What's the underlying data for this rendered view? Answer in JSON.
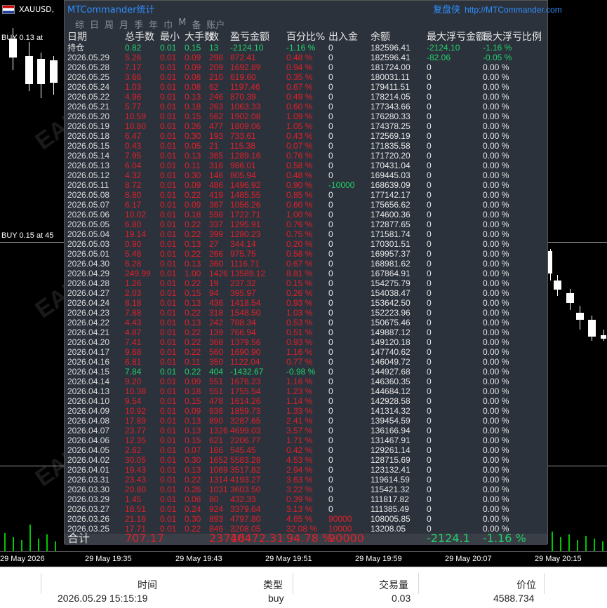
{
  "chart": {
    "symbol": "XAUUSD,",
    "label_top": "BUY 0.13 at",
    "label_mid": "BUY 0.15 at 45",
    "watermark": "EAHub.cn",
    "time_axis": [
      "29 May 2026",
      "29 May 19:35",
      "29 May 19:43",
      "29 May 19:51",
      "29 May 19:59",
      "29 May 20:07",
      "29 May 20:15"
    ]
  },
  "panel": {
    "title": "MTCommander统计",
    "brand": "复盘侠",
    "link": "http://MTCommander.com",
    "tabs": [
      "综",
      "日",
      "周",
      "月",
      "季",
      "年",
      "巾",
      "M",
      "备",
      "账户"
    ],
    "columns": [
      "日期",
      "总手数",
      "最小",
      "大手数",
      "数",
      "盈亏金额",
      "百分比%",
      "出入金",
      "余额",
      "最大浮亏金额",
      "最大浮亏比例"
    ],
    "position_row": [
      "持仓",
      "0.82",
      "0.01",
      "0.15",
      "13",
      "-2124.10",
      "-1.16 %",
      "0",
      "182596.41",
      "-2124.10",
      "-1.16 %"
    ],
    "rows": [
      [
        "2026.05.29",
        "5.26",
        "0.01",
        "0.09",
        "298",
        "872.41",
        "0.48 %",
        "0",
        "182596.41",
        "-82.06",
        "-0.05 %"
      ],
      [
        "2026.05.28",
        "7.17",
        "0.01",
        "0.09",
        "209",
        "1692.89",
        "0.94 %",
        "0",
        "181724.00",
        "0",
        "0.00 %"
      ],
      [
        "2026.05.25",
        "3.66",
        "0.01",
        "0.08",
        "210",
        "619.60",
        "0.35 %",
        "0",
        "180031.11",
        "0",
        "0.00 %"
      ],
      [
        "2026.05.24",
        "1.03",
        "0.01",
        "0.08",
        "62",
        "1197.46",
        "0.67 %",
        "0",
        "179411.51",
        "0",
        "0.00 %"
      ],
      [
        "2026.05.22",
        "4.96",
        "0.01",
        "0.13",
        "246",
        "870.39",
        "0.49 %",
        "0",
        "178214.05",
        "0",
        "0.00 %"
      ],
      [
        "2026.05.21",
        "5.77",
        "0.01",
        "0.18",
        "263",
        "1063.33",
        "0.60 %",
        "0",
        "177343.66",
        "0",
        "0.00 %"
      ],
      [
        "2026.05.20",
        "10.59",
        "0.01",
        "0.15",
        "562",
        "1902.08",
        "1.09 %",
        "0",
        "176280.33",
        "0",
        "0.00 %"
      ],
      [
        "2026.05.19",
        "10.80",
        "0.01",
        "0.26",
        "477",
        "1809.06",
        "1.05 %",
        "0",
        "174378.25",
        "0",
        "0.00 %"
      ],
      [
        "2026.05.18",
        "6.47",
        "0.01",
        "0.30",
        "193",
        "733.61",
        "0.43 %",
        "0",
        "172569.19",
        "0",
        "0.00 %"
      ],
      [
        "2026.05.15",
        "0.43",
        "0.01",
        "0.05",
        "21",
        "115.38",
        "0.07 %",
        "0",
        "171835.58",
        "0",
        "0.00 %"
      ],
      [
        "2026.05.14",
        "7.95",
        "0.01",
        "0.13",
        "365",
        "1289.16",
        "0.76 %",
        "0",
        "171720.20",
        "0",
        "0.00 %"
      ],
      [
        "2026.05.13",
        "6.04",
        "0.01",
        "0.11",
        "316",
        "986.01",
        "0.58 %",
        "0",
        "170431.04",
        "0",
        "0.00 %"
      ],
      [
        "2026.05.12",
        "4.32",
        "0.01",
        "0.30",
        "146",
        "805.94",
        "0.48 %",
        "0",
        "169445.03",
        "0",
        "0.00 %"
      ],
      [
        "2026.05.11",
        "8.72",
        "0.01",
        "0.09",
        "486",
        "1496.92",
        "0.90 %",
        "-10000",
        "168639.09",
        "0",
        "0.00 %"
      ],
      [
        "2026.05.08",
        "8.80",
        "0.01",
        "0.22",
        "419",
        "1485.55",
        "0.85 %",
        "0",
        "177142.17",
        "0",
        "0.00 %"
      ],
      [
        "2026.05.07",
        "6.17",
        "0.01",
        "0.09",
        "367",
        "1056.26",
        "0.60 %",
        "0",
        "175656.62",
        "0",
        "0.00 %"
      ],
      [
        "2026.05.06",
        "10.02",
        "0.01",
        "0.18",
        "598",
        "1722.71",
        "1.00 %",
        "0",
        "174600.36",
        "0",
        "0.00 %"
      ],
      [
        "2026.05.05",
        "6.80",
        "0.01",
        "0.22",
        "337",
        "1295.91",
        "0.76 %",
        "0",
        "172877.65",
        "0",
        "0.00 %"
      ],
      [
        "2026.05.04",
        "19.14",
        "0.01",
        "0.22",
        "399",
        "1280.23",
        "0.75 %",
        "0",
        "171581.74",
        "0",
        "0.00 %"
      ],
      [
        "2026.05.03",
        "0.90",
        "0.01",
        "0.13",
        "27",
        "344.14",
        "0.20 %",
        "0",
        "170301.51",
        "0",
        "0.00 %"
      ],
      [
        "2026.05.01",
        "5.48",
        "0.01",
        "0.22",
        "266",
        "975.75",
        "0.58 %",
        "0",
        "169957.37",
        "0",
        "0.00 %"
      ],
      [
        "2026.04.30",
        "6.28",
        "0.01",
        "0.13",
        "360",
        "1116.71",
        "0.67 %",
        "0",
        "168981.62",
        "0",
        "0.00 %"
      ],
      [
        "2026.04.29",
        "249.99",
        "0.01",
        "1.00",
        "1426",
        "13589.12",
        "8.81 %",
        "0",
        "167864.91",
        "0",
        "0.00 %"
      ],
      [
        "2026.04.28",
        "1.26",
        "0.01",
        "0.22",
        "19",
        "237.32",
        "0.15 %",
        "0",
        "154275.79",
        "0",
        "0.00 %"
      ],
      [
        "2026.04.27",
        "2.03",
        "0.01",
        "0.15",
        "94",
        "395.97",
        "0.26 %",
        "0",
        "154038.47",
        "0",
        "0.00 %"
      ],
      [
        "2026.04.24",
        "8.18",
        "0.01",
        "0.13",
        "436",
        "1418.54",
        "0.93 %",
        "0",
        "153642.50",
        "0",
        "0.00 %"
      ],
      [
        "2026.04.23",
        "7.88",
        "0.01",
        "0.22",
        "318",
        "1548.50",
        "1.03 %",
        "0",
        "152223.96",
        "0",
        "0.00 %"
      ],
      [
        "2026.04.22",
        "4.43",
        "0.01",
        "0.13",
        "242",
        "788.34",
        "0.53 %",
        "0",
        "150675.46",
        "0",
        "0.00 %"
      ],
      [
        "2026.04.21",
        "4.87",
        "0.01",
        "0.22",
        "139",
        "766.94",
        "0.51 %",
        "0",
        "149887.12",
        "0",
        "0.00 %"
      ],
      [
        "2026.04.20",
        "7.41",
        "0.01",
        "0.22",
        "368",
        "1379.56",
        "0.93 %",
        "0",
        "149120.18",
        "0",
        "0.00 %"
      ],
      [
        "2026.04.17",
        "9.68",
        "0.01",
        "0.22",
        "560",
        "1690.90",
        "1.16 %",
        "0",
        "147740.62",
        "0",
        "0.00 %"
      ],
      [
        "2026.04.16",
        "6.81",
        "0.01",
        "0.11",
        "350",
        "1122.04",
        "0.77 %",
        "0",
        "146049.72",
        "0",
        "0.00 %"
      ],
      [
        "2026.04.15",
        "7.84",
        "0.01",
        "0.22",
        "404",
        "-1432.67",
        "-0.98 %",
        "0",
        "144927.68",
        "0",
        "0.00 %"
      ],
      [
        "2026.04.14",
        "9.20",
        "0.01",
        "0.09",
        "551",
        "1676.23",
        "1.16 %",
        "0",
        "146360.35",
        "0",
        "0.00 %"
      ],
      [
        "2026.04.13",
        "10.38",
        "0.01",
        "0.18",
        "551",
        "1755.54",
        "1.23 %",
        "0",
        "144684.12",
        "0",
        "0.00 %"
      ],
      [
        "2026.04.10",
        "9.54",
        "0.01",
        "0.15",
        "478",
        "1614.26",
        "1.14 %",
        "0",
        "142928.58",
        "0",
        "0.00 %"
      ],
      [
        "2026.04.09",
        "10.92",
        "0.01",
        "0.09",
        "636",
        "1859.73",
        "1.33 %",
        "0",
        "141314.32",
        "0",
        "0.00 %"
      ],
      [
        "2026.04.08",
        "17.89",
        "0.01",
        "0.13",
        "890",
        "3287.65",
        "2.41 %",
        "0",
        "139454.59",
        "0",
        "0.00 %"
      ],
      [
        "2026.04.07",
        "23.77",
        "0.01",
        "0.13",
        "1326",
        "4699.03",
        "3.57 %",
        "0",
        "136166.94",
        "0",
        "0.00 %"
      ],
      [
        "2026.04.06",
        "12.35",
        "0.01",
        "0.15",
        "621",
        "2206.77",
        "1.71 %",
        "0",
        "131467.91",
        "0",
        "0.00 %"
      ],
      [
        "2026.04.05",
        "2.62",
        "0.01",
        "0.07",
        "166",
        "545.45",
        "0.42 %",
        "0",
        "129261.14",
        "0",
        "0.00 %"
      ],
      [
        "2026.04.02",
        "30.05",
        "0.01",
        "0.30",
        "1652",
        "5583.28",
        "4.53 %",
        "0",
        "128715.69",
        "0",
        "0.00 %"
      ],
      [
        "2026.04.01",
        "19.43",
        "0.01",
        "0.13",
        "1069",
        "3517.82",
        "2.94 %",
        "0",
        "123132.41",
        "0",
        "0.00 %"
      ],
      [
        "2026.03.31",
        "23.43",
        "0.01",
        "0.22",
        "1314",
        "4193.27",
        "3.63 %",
        "0",
        "119614.59",
        "0",
        "0.00 %"
      ],
      [
        "2026.03.30",
        "20.80",
        "0.01",
        "0.26",
        "1031",
        "3603.50",
        "3.22 %",
        "0",
        "115421.32",
        "0",
        "0.00 %"
      ],
      [
        "2026.03.29",
        "1.45",
        "0.01",
        "0.08",
        "80",
        "432.33",
        "0.39 %",
        "0",
        "111817.82",
        "0",
        "0.00 %"
      ],
      [
        "2026.03.27",
        "18.51",
        "0.01",
        "0.24",
        "924",
        "3379.64",
        "3.13 %",
        "0",
        "111385.49",
        "0",
        "0.00 %"
      ],
      [
        "2026.03.26",
        "21.16",
        "0.01",
        "0.30",
        "893",
        "4797.80",
        "4.65 %",
        "90000",
        "108005.85",
        "0",
        "0.00 %"
      ],
      [
        "2026.03.25",
        "17.71",
        "0.01",
        "0.22",
        "846",
        "3208.05",
        "32.08 %",
        "10000",
        "13208.05",
        "0",
        "0.00 %"
      ]
    ],
    "total_row": [
      "合计",
      "707.17",
      "",
      "",
      "23716",
      "40472.31",
      "94.78 %",
      "90000",
      "",
      "-2124.1",
      "-1.16 %"
    ]
  },
  "bottom": {
    "headers": [
      "时间",
      "类型",
      "交易量",
      "价位"
    ],
    "values": [
      "2026.05.29 15:15:19",
      "buy",
      "0.03",
      "4588.734"
    ]
  }
}
